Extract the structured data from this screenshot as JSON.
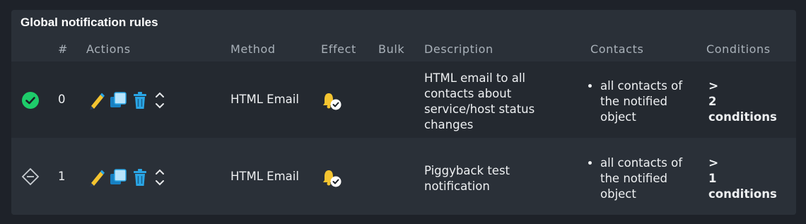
{
  "panel": {
    "title": "Global notification rules"
  },
  "columns": {
    "number": "#",
    "actions": "Actions",
    "method": "Method",
    "effect": "Effect",
    "bulk": "Bulk",
    "description": "Description",
    "contacts": "Contacts",
    "conditions": "Conditions"
  },
  "rows": [
    {
      "status": "enabled",
      "number": "0",
      "method": "HTML Email",
      "effect_icon": "bell-check-icon",
      "bulk": "",
      "description_lines": [
        "HTML email to all",
        "contacts about",
        "service/host status",
        "changes"
      ],
      "contacts_lines": [
        "all contacts of",
        "the notified",
        "object"
      ],
      "conditions_arrow": ">",
      "conditions_count": "2",
      "conditions_label": "conditions"
    },
    {
      "status": "disabled",
      "number": "1",
      "method": "HTML Email",
      "effect_icon": "bell-check-icon",
      "bulk": "",
      "description_lines": [
        "Piggyback test",
        "notification"
      ],
      "contacts_lines": [
        "all contacts of",
        "the notified",
        "object"
      ],
      "conditions_arrow": ">",
      "conditions_count": "1",
      "conditions_label": "conditions"
    }
  ],
  "colors": {
    "ok_green": "#1ecc6a",
    "edit_yellow": "#f4c430",
    "blue": "#2aa6e6"
  }
}
